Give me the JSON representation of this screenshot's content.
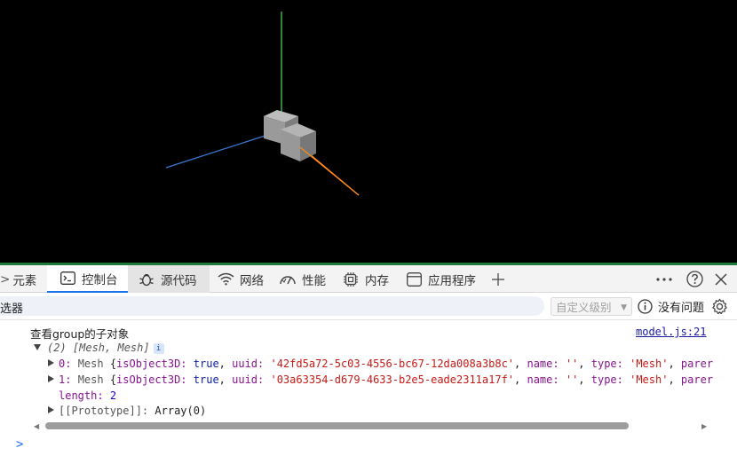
{
  "tabs": {
    "elements": "元素",
    "console": "控制台",
    "sources": "源代码",
    "network": "网络",
    "performance": "性能",
    "memory": "内存",
    "application": "应用程序",
    "add_symbol": "+"
  },
  "filter": {
    "label": "选器",
    "levels": "自定义级别",
    "issues": "没有问题"
  },
  "console": {
    "log_text": "查看group的子对象",
    "log_source": "model.js:21",
    "array_summary": "(2) [Mesh, Mesh]",
    "info_badge": "i",
    "item0": {
      "index": "0:",
      "type_name": "Mesh",
      "isObject3D_key": "isObject3D:",
      "isObject3D_val": "true",
      "uuid_key": "uuid:",
      "uuid_val": "'42fd5a72-5c03-4556-bc67-12da008a3b8c'",
      "name_key": "name:",
      "name_val": "''",
      "type_key": "type:",
      "type_val": "'Mesh'",
      "tail": "parer"
    },
    "item1": {
      "index": "1:",
      "type_name": "Mesh",
      "isObject3D_key": "isObject3D:",
      "isObject3D_val": "true",
      "uuid_key": "uuid:",
      "uuid_val": "'03a63354-d679-4633-b2e5-eade2311a17f'",
      "name_key": "name:",
      "name_val": "''",
      "type_key": "type:",
      "type_val": "'Mesh'",
      "tail": "parer"
    },
    "length_key": "length:",
    "length_val": "2",
    "prototype_key": "[[Prototype]]:",
    "prototype_val": "Array(0)",
    "prompt": ">"
  },
  "colors": {
    "viewport_bg": "#000000",
    "axis_x": "#ff8c1a",
    "axis_y": "#5cd65c",
    "axis_z": "#3a7bd5",
    "active_tab_accent": "#1a73e8"
  }
}
